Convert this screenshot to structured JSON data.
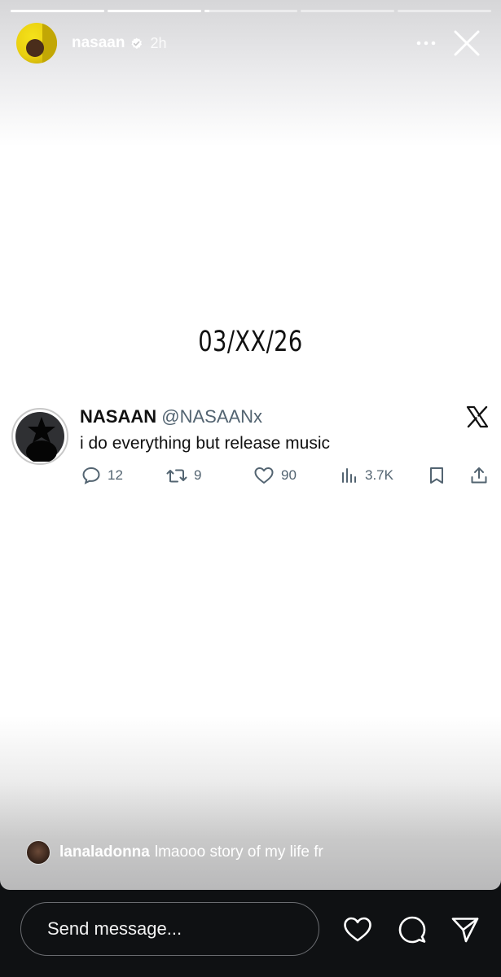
{
  "story": {
    "progress": [
      1,
      1,
      0.06,
      0,
      0
    ],
    "username": "nasaan",
    "time": "2h",
    "date_text": "03/XX/26"
  },
  "tweet": {
    "name": "NASAAN",
    "handle": "@NASAANx",
    "text": "i do everything but release music",
    "replies": "12",
    "retweets": "9",
    "likes": "90",
    "views": "3.7K"
  },
  "reply": {
    "username": "lanaladonna",
    "text": "lmaooo story of my life fr"
  },
  "composer": {
    "placeholder": "Send message..."
  },
  "colors": {
    "accent_dark": "#0f1113",
    "tweet_grey": "#536471"
  },
  "icons": [
    "verified-icon",
    "more-icon",
    "close-icon",
    "x-logo-icon",
    "reply-icon",
    "retweet-icon",
    "like-icon",
    "views-icon",
    "bookmark-icon",
    "share-icon",
    "heart-icon",
    "comment-icon",
    "send-icon"
  ]
}
